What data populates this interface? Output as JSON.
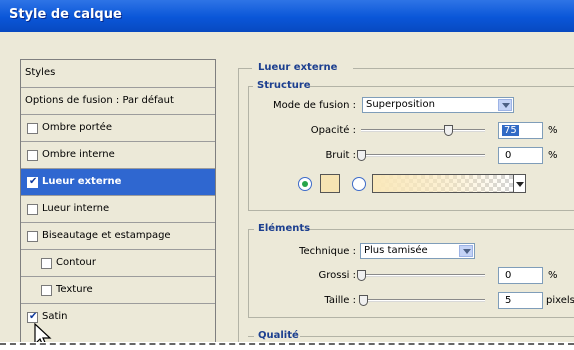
{
  "window": {
    "title": "Style de calque"
  },
  "style_list": {
    "header": "Styles",
    "items": [
      {
        "label": "Options de fusion : Par défaut",
        "checkbox": false,
        "checked": false,
        "selected": false
      },
      {
        "label": "Ombre portée",
        "checkbox": true,
        "checked": false,
        "selected": false
      },
      {
        "label": "Ombre interne",
        "checkbox": true,
        "checked": false,
        "selected": false
      },
      {
        "label": "Lueur externe",
        "checkbox": true,
        "checked": true,
        "selected": true
      },
      {
        "label": "Lueur interne",
        "checkbox": true,
        "checked": false,
        "selected": false
      },
      {
        "label": "Biseautage et estampage",
        "checkbox": true,
        "checked": false,
        "selected": false
      },
      {
        "label": "Contour",
        "checkbox": true,
        "checked": false,
        "selected": false
      },
      {
        "label": "Texture",
        "checkbox": true,
        "checked": false,
        "selected": false
      },
      {
        "label": "Satin",
        "checkbox": true,
        "checked": true,
        "selected": false
      }
    ]
  },
  "panel": {
    "title": "Lueur externe",
    "structure": {
      "title": "Structure",
      "blend_mode": {
        "label": "Mode de fusion :",
        "value": "Superposition"
      },
      "opacity": {
        "label": "Opacité :",
        "value": "75",
        "unit": "%",
        "level": 0.75
      },
      "noise": {
        "label": "Bruit :",
        "value": "0",
        "unit": "%",
        "level": 0
      },
      "fill": {
        "selected": "color",
        "color": "#f7e4b3",
        "gradient_color": "#fae8ba"
      }
    },
    "elements": {
      "title": "Eléments",
      "technique": {
        "label": "Technique :",
        "value": "Plus tamisée"
      },
      "spread": {
        "label": "Grossi :",
        "value": "0",
        "unit": "%",
        "level": 0
      },
      "size": {
        "label": "Taille :",
        "value": "5",
        "unit": "pixels",
        "level": 0.02
      }
    },
    "quality": {
      "title": "Qualité"
    }
  },
  "colors": {
    "titlebar": "#0a56d8",
    "selection": "#2f67d0",
    "section_title": "#1c3f8f"
  }
}
